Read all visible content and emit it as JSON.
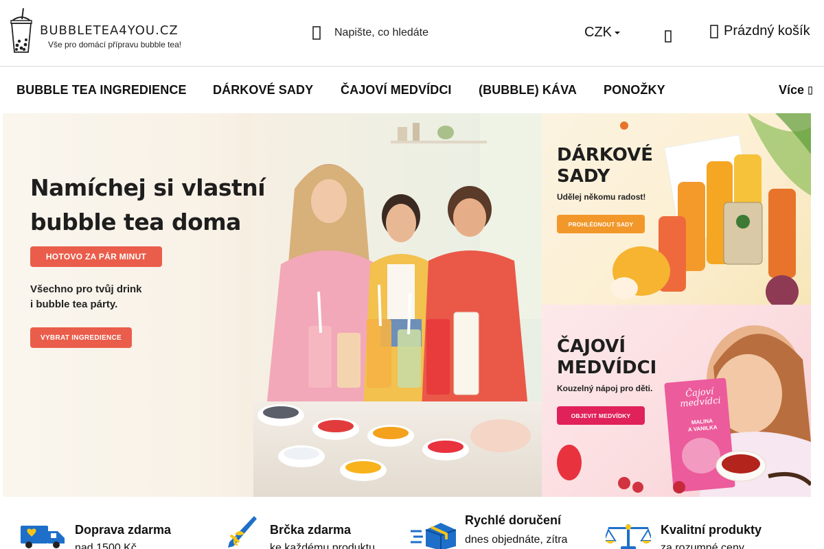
{
  "header": {
    "logo_name": "BUBBLETEA4YOU.CZ",
    "logo_tagline": "Vše pro domácí přípravu bubble tea!",
    "search_placeholder": "Napište, co hledáte",
    "currency": "CZK",
    "cart_label": "Prázdný košík"
  },
  "nav": {
    "items": [
      "BUBBLE TEA INGREDIENCE",
      "DÁRKOVÉ SADY",
      "ČAJOVÍ MEDVÍDCI",
      "(BUBBLE) KÁVA",
      "PONOŽKY"
    ],
    "more_label": "Více"
  },
  "hero": {
    "title_line1": "Namíchej si vlastní",
    "title_line2": "bubble tea doma",
    "badge": "HOTOVO ZA PÁR MINUT",
    "text_line1": "Všechno pro tvůj drink",
    "text_line2": "i bubble tea párty.",
    "cta": "VYBRAT INGREDIENCE"
  },
  "promos": {
    "gifts": {
      "title_line1": "DÁRKOVÉ",
      "title_line2": "SADY",
      "subtitle": "Udělej někomu radost!",
      "button": "PROHLÉDNOUT SADY"
    },
    "bears": {
      "title_line1": "ČAJOVÍ",
      "title_line2": "MEDVÍDCI",
      "subtitle": "Kouzelný nápoj pro děti.",
      "button": "OBJEVIT MEDVÍDKY",
      "pack_line1": "Čajoví",
      "pack_line2": "medvídci",
      "pack_flavor1": "MALINA",
      "pack_flavor2": "A VANILKA"
    }
  },
  "benefits": [
    {
      "title": "Doprava zdarma",
      "desc": "nad 1500 Kč",
      "icon": "delivery-truck-icon"
    },
    {
      "title": "Brčka zdarma",
      "desc": "ke každému produktu",
      "icon": "straw-icon"
    },
    {
      "title": "Rychlé doručení",
      "desc": "dnes objednáte, zítra",
      "icon": "fast-box-icon"
    },
    {
      "title": "Kvalitní produkty",
      "desc": "za rozumné ceny",
      "icon": "scales-icon"
    }
  ],
  "colors": {
    "accent": "#ea5d4b",
    "icon_blue": "#1e6fc9",
    "icon_yellow": "#f5c518"
  }
}
